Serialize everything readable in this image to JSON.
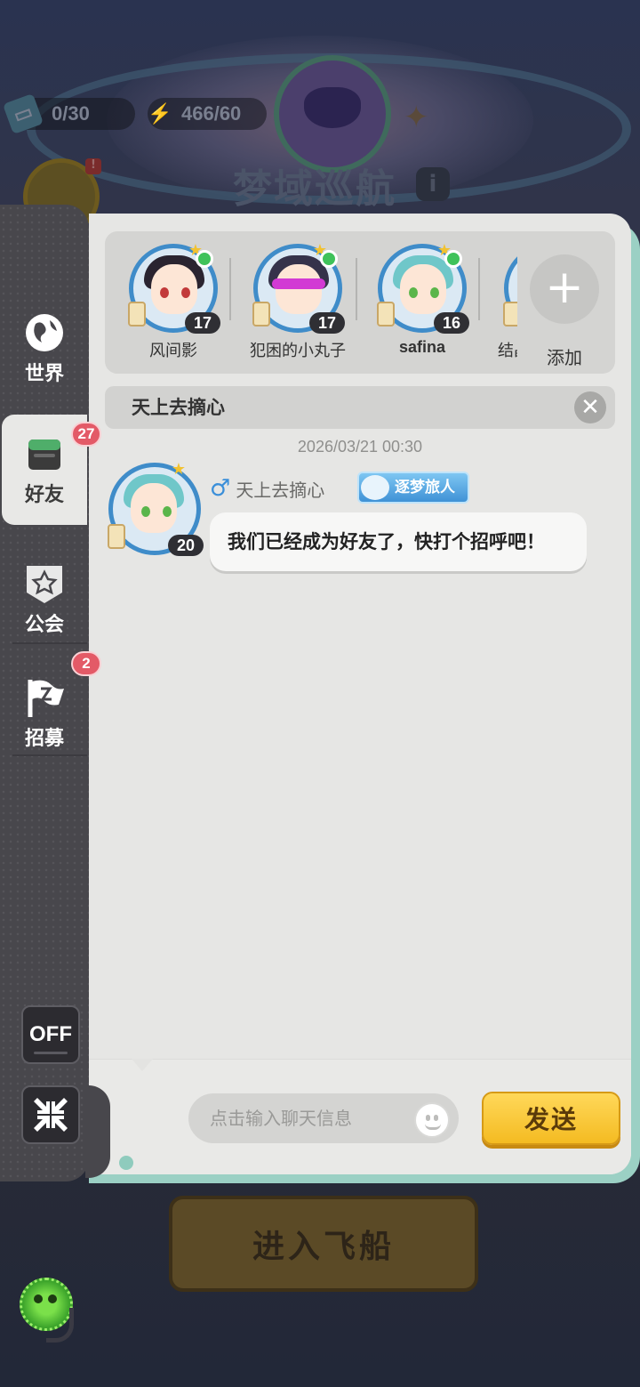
{
  "background": {
    "ticket_count": "0/30",
    "energy": "466/60",
    "title": "梦域巡航",
    "enter_button": "进入飞船"
  },
  "sidebar": {
    "items": [
      {
        "label": "世界",
        "icon": "globe-icon"
      },
      {
        "label": "好友",
        "icon": "book-icon",
        "badge": "27"
      },
      {
        "label": "公会",
        "icon": "shield-star-icon"
      },
      {
        "label": "招募",
        "icon": "flag-icon",
        "badge": "2"
      }
    ],
    "off_label": "OFF"
  },
  "friends": [
    {
      "name": "风间影",
      "level": "17",
      "online": true,
      "hair": "#2a2430"
    },
    {
      "name": "犯困的小丸子",
      "level": "17",
      "online": true,
      "hair": "#35324a"
    },
    {
      "name": "safina",
      "level": "16",
      "online": true,
      "hair": "#6fc7c9"
    },
    {
      "name": "结晶",
      "level": "",
      "online": false,
      "hair": "#6fc7c9"
    }
  ],
  "add_label": "添加",
  "chat": {
    "title": "天上去摘心",
    "timestamp": "2026/03/21  00:30",
    "message": {
      "sender": "天上去摘心",
      "gender_icon": "male-icon",
      "title_tag": "逐梦旅人",
      "level": "20",
      "text": "我们已经成为好友了，快打个招呼吧！"
    }
  },
  "input": {
    "placeholder": "点击输入聊天信息",
    "send_label": "发送"
  },
  "colors": {
    "accent_gold": "#f4bb22",
    "badge_red": "#e35a67",
    "avatar_ring": "#3f8cc9",
    "panel_bg": "#e6e6e4"
  }
}
